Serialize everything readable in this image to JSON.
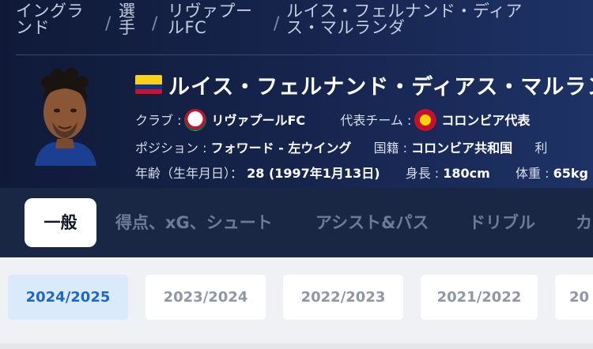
{
  "breadcrumb": {
    "items": [
      "イングランド",
      "選手",
      "リヴァプールFC",
      "ルイス・フェルナンド・ディアス・マルランダ"
    ],
    "items_display": [
      "イングラ\nンド",
      "選\n手",
      "リヴァプー\nルFC",
      "ルイス・フェルナンド・ディア\nス・マルランダ"
    ],
    "separator": "/"
  },
  "player": {
    "name": "ルイス・フェルナンド・ディアス・マルランダ",
    "flag": [
      "#fcd116",
      "#003893",
      "#ce1126"
    ],
    "club_label": "クラブ :",
    "club_value": "リヴァプールFC",
    "national_label": "代表チーム :",
    "national_value": "コロンビア代表",
    "position_label": "ポジション :",
    "position_value": "フォワード - 左ウイング",
    "nationality_label": "国籍 :",
    "nationality_value": "コロンビア共和国",
    "extra_label": "利",
    "age_label": "年齢（生年月日）：",
    "age_value": "28 (1997年1月13日)",
    "height_label": "身長 :",
    "height_value": "180cm",
    "weight_label": "体重 :",
    "weight_value": "65kg"
  },
  "tabs": [
    "一般",
    "得点、xG、シュート",
    "アシスト&パス",
    "ドリブル",
    "カ"
  ],
  "seasons": [
    "2024/2025",
    "2023/2024",
    "2022/2023",
    "2021/2022",
    "20"
  ],
  "colors": {
    "header_bg": "#17254f",
    "accent": "#1d67c8",
    "active_season_bg": "#dbeafa"
  }
}
